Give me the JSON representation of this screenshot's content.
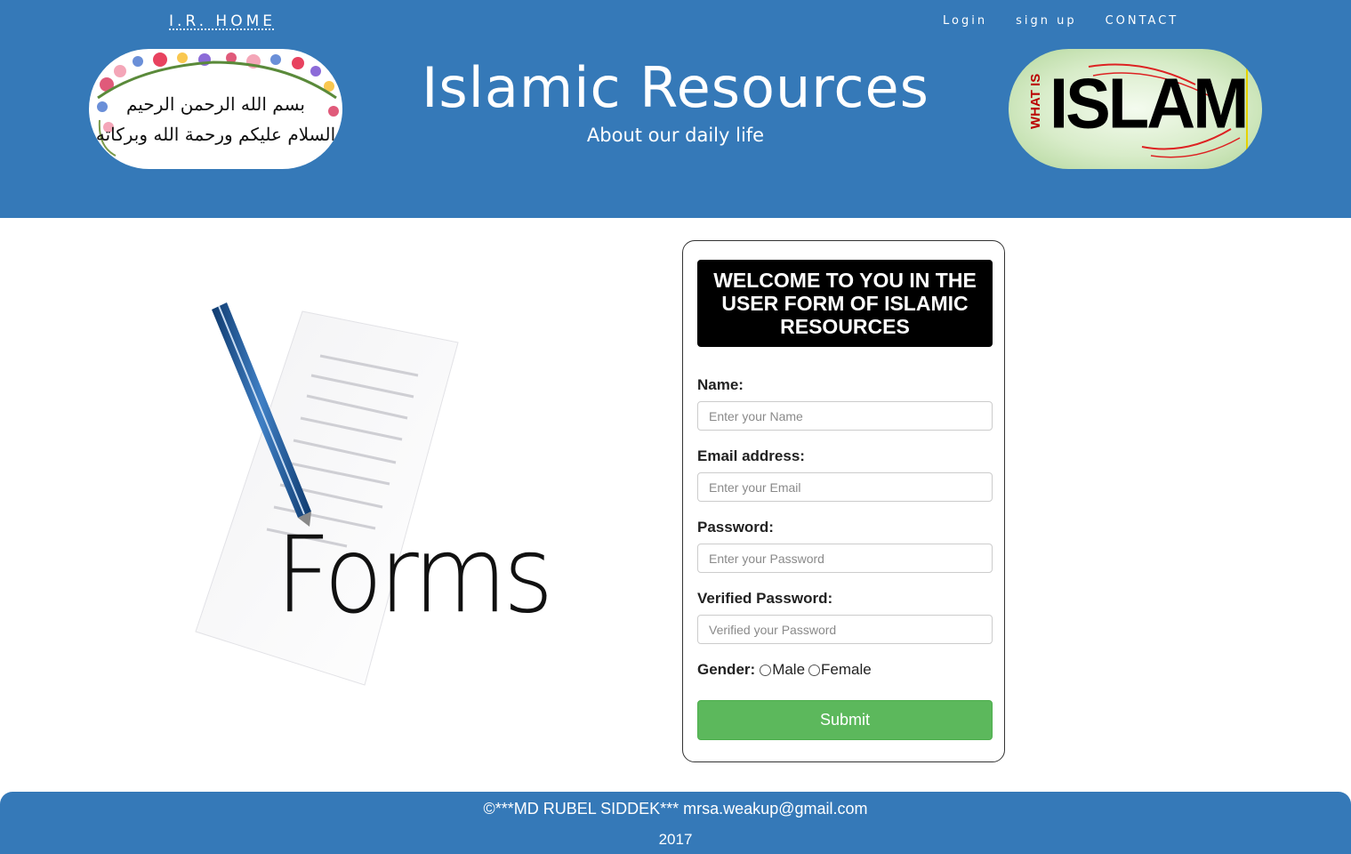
{
  "nav": {
    "home": "I.R. HOME",
    "links": [
      "Login",
      "sign up",
      "CONTACT"
    ]
  },
  "header": {
    "title": "Islamic Resources",
    "subtitle": "About our daily life",
    "left_banner_text": [
      "بسم الله الرحمن الرحيم",
      "السلام عليكم ورحمة الله وبركاته"
    ],
    "right_banner_text": {
      "small": "WHAT IS",
      "big": "ISLAM"
    }
  },
  "illustration": {
    "caption": "Forms"
  },
  "form": {
    "title": "WELCOME TO YOU IN THE USER FORM OF ISLAMIC RESOURCES",
    "name_label": "Name:",
    "name_placeholder": "Enter your Name",
    "email_label": "Email address:",
    "email_placeholder": "Enter your Email",
    "password_label": "Password:",
    "password_placeholder": "Enter your Password",
    "verify_label": "Verified Password:",
    "verify_placeholder": "Verified your Password",
    "gender_label": "Gender:",
    "gender_options": [
      "Male",
      "Female"
    ],
    "submit_label": "Submit"
  },
  "footer": {
    "line1": "©***MD RUBEL SIDDEK*** mrsa.weakup@gmail.com",
    "line2": "2017"
  },
  "colors": {
    "header_bg": "#3579b8",
    "submit_bg": "#5cb85c",
    "title_box_bg": "#000000"
  }
}
